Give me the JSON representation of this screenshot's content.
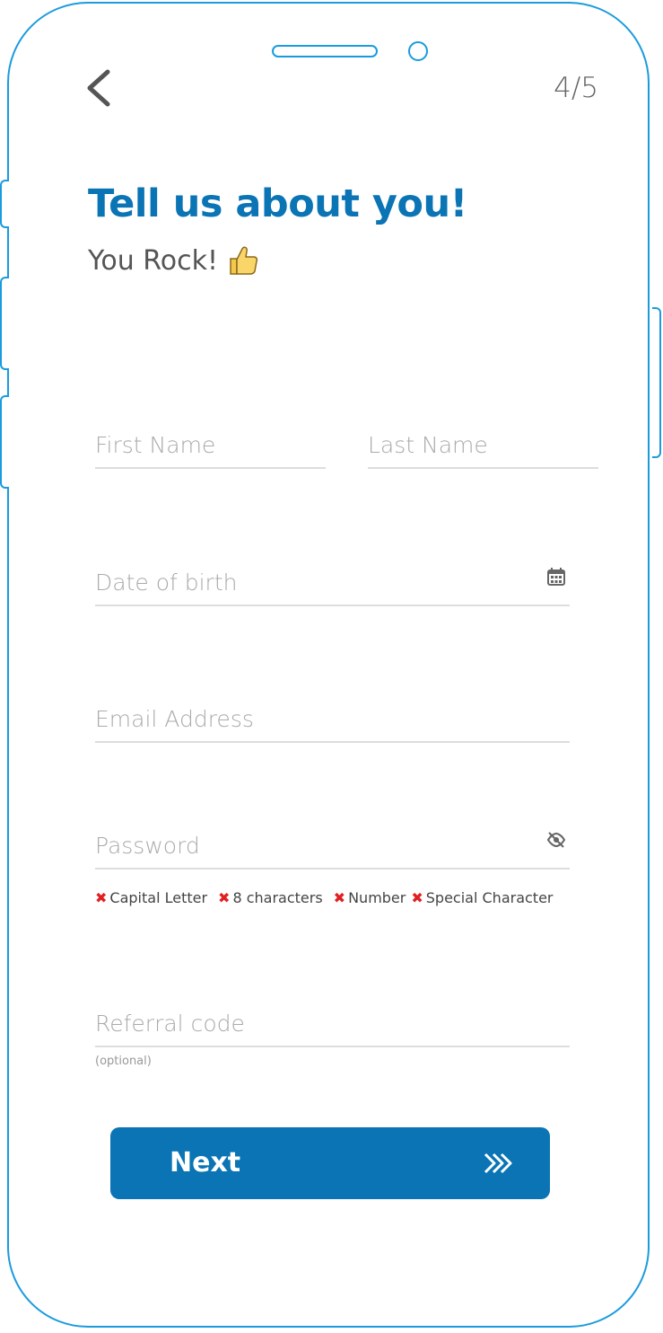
{
  "header": {
    "back_icon": "chevron-left-icon",
    "step": "4/5"
  },
  "intro": {
    "title": "Tell us about you!",
    "subtitle": "You Rock!",
    "subtitle_icon": "thumbs-up-icon"
  },
  "form": {
    "first_name": {
      "placeholder": "First Name",
      "value": ""
    },
    "last_name": {
      "placeholder": "Last Name",
      "value": ""
    },
    "dob": {
      "placeholder": "Date of birth",
      "value": "",
      "icon": "calendar-icon"
    },
    "email": {
      "placeholder": "Email Address",
      "value": ""
    },
    "password": {
      "placeholder": "Password",
      "value": "",
      "icon": "eye-off-icon"
    },
    "password_rules": [
      {
        "label": "Capital Letter",
        "met": false
      },
      {
        "label": "8 characters",
        "met": false
      },
      {
        "label": "Number",
        "met": false
      },
      {
        "label": "Special Character",
        "met": false
      }
    ],
    "referral": {
      "placeholder": "Referral code",
      "value": "",
      "hint": "(optional)"
    }
  },
  "actions": {
    "next_label": "Next",
    "next_icon": "double-chevron-right-icon"
  },
  "colors": {
    "frame": "#1a9bde",
    "brand": "#0a74b5",
    "error": "#e02020"
  }
}
